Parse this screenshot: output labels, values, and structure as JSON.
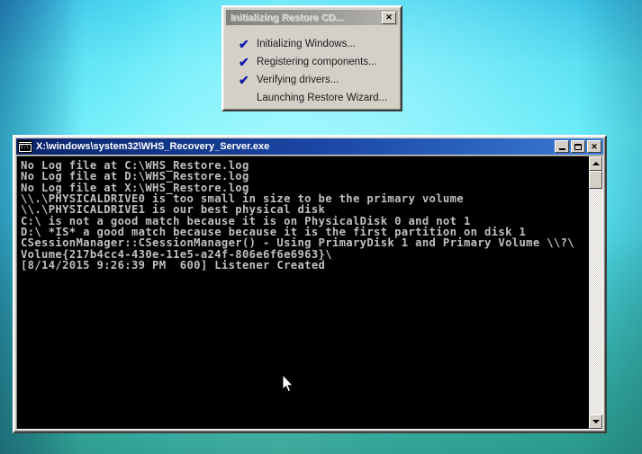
{
  "desktop": {
    "background_top_color": "#86ddec",
    "background_bottom_color": "#4ea07c",
    "cursor_icon": "arrow-pointer-icon"
  },
  "restore_dialog": {
    "title": "Initializing Restore CD...",
    "close_label": "✕",
    "close_icon": "close-icon",
    "check_glyph": "✔",
    "steps": [
      {
        "label": "Initializing Windows...",
        "checked": true
      },
      {
        "label": "Registering components...",
        "checked": true
      },
      {
        "label": "Verifying drivers...",
        "checked": true
      },
      {
        "label": "Launching Restore Wizard...",
        "checked": false
      }
    ]
  },
  "console_window": {
    "title": "X:\\windows\\system32\\WHS_Recovery_Server.exe",
    "icon": "console-window-icon",
    "icon_prompt": "C:\\",
    "minimize_label": "–",
    "maximize_label": "□",
    "close_label": "✕",
    "text_color": "#c0c0c0",
    "background_color": "#000000",
    "lines": [
      "No Log file at C:\\WHS_Restore.log",
      "No Log file at D:\\WHS_Restore.log",
      "No Log file at X:\\WHS_Restore.log",
      "\\\\.\\PHYSICALDRIVE0 is too small in size to be the primary volume",
      "\\\\.\\PHYSICALDRIVE1 is our best physical disk",
      "C:\\ is not a good match because it is on PhysicalDisk 0 and not 1",
      "D:\\ *IS* a good match because because it is the first partition on disk 1",
      "CSessionManager::CSessionManager() - Using PrimaryDisk 1 and Primary Volume \\\\?\\",
      "Volume{217b4cc4-430e-11e5-a24f-806e6f6e6963}\\",
      "[8/14/2015 9:26:39 PM  600] Listener Created"
    ],
    "scrollbar": {
      "up_arrow_icon": "scroll-up-arrow-icon",
      "down_arrow_icon": "scroll-down-arrow-icon",
      "thumb_position_percent": 0
    }
  }
}
